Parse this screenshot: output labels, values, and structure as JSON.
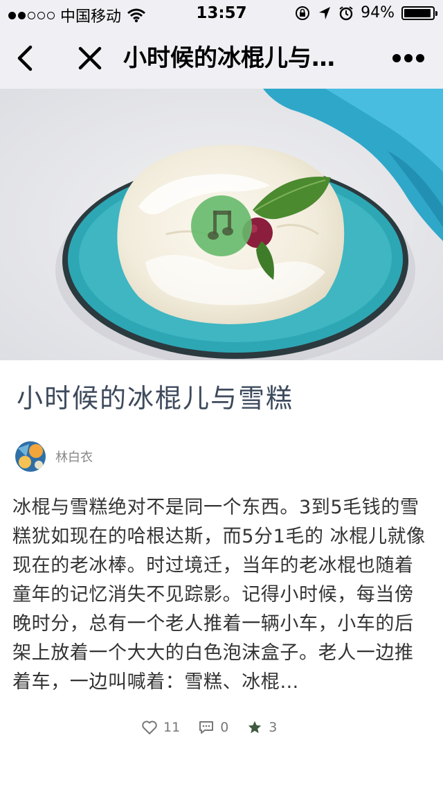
{
  "status_bar": {
    "carrier": "中国移动",
    "time": "13:57",
    "battery_percent": "94%",
    "battery_level": 0.94,
    "signal_bars_filled": 2,
    "signal_bars_total": 5
  },
  "nav": {
    "title": "小时候的冰棍儿与…",
    "icons": [
      "back-icon",
      "close-icon",
      "more-icon"
    ]
  },
  "article": {
    "title": "小时候的冰棍儿与雪糕",
    "author": "林白衣",
    "body": "冰棍与雪糕绝对不是同一个东西。3到5毛钱的雪糕犹如现在的哈根达斯，而5分1毛的 冰棍儿就像现在的老冰棒。时过境迁，当年的老冰棍也随着童年的记忆消失不见踪影。记得小时候，每当傍晚时分，总有一个老人推着一辆小车，小车的后架上放着一个大大的白色泡沫盒子。老人一边推着车，一边叫喊着：雪糕、冰棍…"
  },
  "stats": {
    "likes": "11",
    "comments": "0",
    "stars": "3"
  },
  "colors": {
    "nav_bg": "#efeff4",
    "title_color": "#3d4a5c",
    "music_button": "#66ba6c",
    "bowl_teal": "#2ea7b5"
  }
}
